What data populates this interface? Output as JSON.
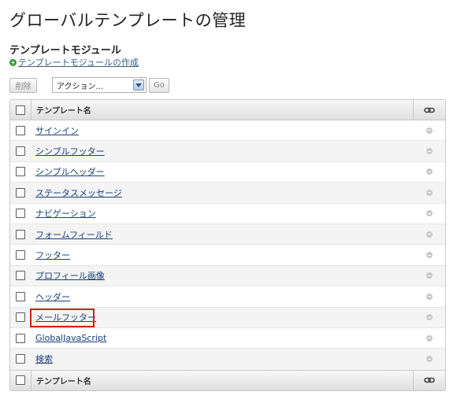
{
  "page": {
    "title": "グローバルテンプレートの管理"
  },
  "section": {
    "title": "テンプレートモジュール",
    "create_link": "テンプレートモジュールの作成"
  },
  "toolbar": {
    "delete_label": "削除",
    "action_selected": "アクション...",
    "go_label": "Go"
  },
  "table": {
    "header_name": "テンプレート名",
    "footer_name": "テンプレート名",
    "rows": [
      {
        "name": "サインイン"
      },
      {
        "name": "シンプルフッター"
      },
      {
        "name": "シンプルヘッダー"
      },
      {
        "name": "ステータスメッセージ"
      },
      {
        "name": "ナビゲーション"
      },
      {
        "name": "フォームフィールド"
      },
      {
        "name": "フッター"
      },
      {
        "name": "プロフィール画像"
      },
      {
        "name": "ヘッダー"
      },
      {
        "name": "メールフッター",
        "highlighted": true
      },
      {
        "name": "GlobalJavaScript"
      },
      {
        "name": "検索"
      }
    ]
  },
  "icons": {
    "create": "plus-circle-icon",
    "link_column": "link-chain-icon",
    "row_status": "minus-circle-icon",
    "dropdown": "chevron-down-icon"
  },
  "colors": {
    "link": "#1b3f7a",
    "highlight_border": "#d21f1f",
    "create_icon": "#2e9c2e"
  }
}
